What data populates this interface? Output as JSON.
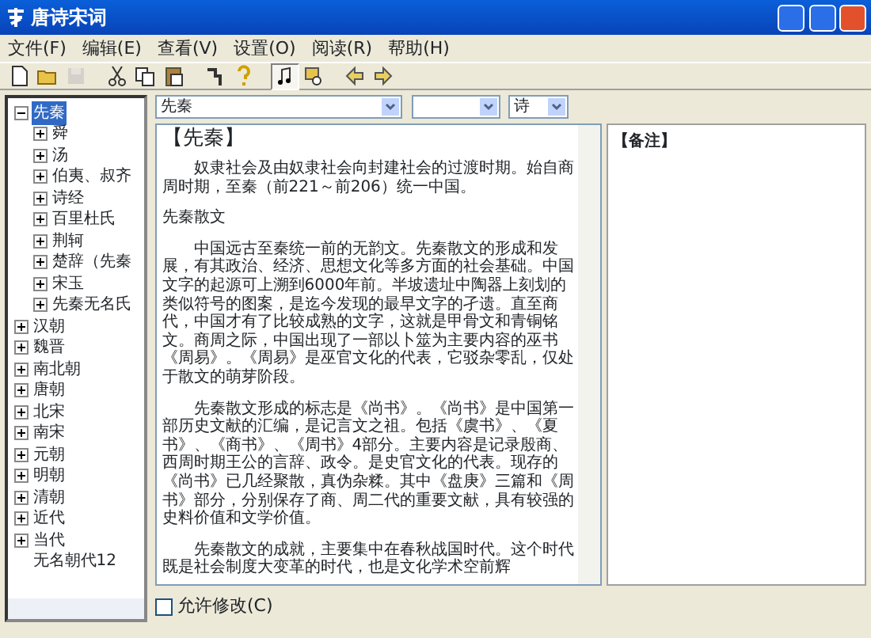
{
  "window": {
    "title": "唐诗宋词"
  },
  "menu": [
    {
      "label": "文件(F)"
    },
    {
      "label": "编辑(E)"
    },
    {
      "label": "查看(V)"
    },
    {
      "label": "设置(O)"
    },
    {
      "label": "阅读(R)"
    },
    {
      "label": "帮助(H)"
    }
  ],
  "toolbar": [
    {
      "kind": "new",
      "disabled": false,
      "pressed": false
    },
    {
      "kind": "open",
      "disabled": false,
      "pressed": false
    },
    {
      "kind": "save",
      "disabled": true,
      "pressed": false
    },
    {
      "kind": "sep"
    },
    {
      "kind": "cut",
      "disabled": false,
      "pressed": false
    },
    {
      "kind": "copy",
      "disabled": false,
      "pressed": false
    },
    {
      "kind": "paste",
      "disabled": false,
      "pressed": false
    },
    {
      "kind": "sep"
    },
    {
      "kind": "steps",
      "disabled": false,
      "pressed": false
    },
    {
      "kind": "help",
      "disabled": false,
      "pressed": false
    },
    {
      "kind": "sep"
    },
    {
      "kind": "note",
      "disabled": false,
      "pressed": true
    },
    {
      "kind": "find",
      "disabled": false,
      "pressed": false
    },
    {
      "kind": "sep"
    },
    {
      "kind": "back",
      "disabled": false,
      "pressed": false
    },
    {
      "kind": "forward",
      "disabled": false,
      "pressed": false
    }
  ],
  "tree": [
    {
      "label": "先秦",
      "expanded": true,
      "selected": true,
      "children": [
        {
          "label": "舜",
          "expanded": false,
          "selected": false
        },
        {
          "label": "汤",
          "expanded": false,
          "selected": false
        },
        {
          "label": "伯夷、叔齐",
          "expanded": false,
          "selected": false
        },
        {
          "label": "诗经",
          "expanded": false,
          "selected": false
        },
        {
          "label": "百里杜氏",
          "expanded": false,
          "selected": false
        },
        {
          "label": "荆轲",
          "expanded": false,
          "selected": false
        },
        {
          "label": "楚辞（先秦",
          "expanded": false,
          "selected": false
        },
        {
          "label": "宋玉",
          "expanded": false,
          "selected": false
        },
        {
          "label": "先秦无名氏",
          "expanded": false,
          "selected": false
        }
      ]
    },
    {
      "label": "汉朝",
      "expanded": false,
      "selected": false
    },
    {
      "label": "魏晋",
      "expanded": false,
      "selected": false
    },
    {
      "label": "南北朝",
      "expanded": false,
      "selected": false
    },
    {
      "label": "唐朝",
      "expanded": false,
      "selected": false
    },
    {
      "label": "北宋",
      "expanded": false,
      "selected": false
    },
    {
      "label": "南宋",
      "expanded": false,
      "selected": false
    },
    {
      "label": "元朝",
      "expanded": false,
      "selected": false
    },
    {
      "label": "明朝",
      "expanded": false,
      "selected": false
    },
    {
      "label": "清朝",
      "expanded": false,
      "selected": false
    },
    {
      "label": "近代",
      "expanded": false,
      "selected": false
    },
    {
      "label": "当代",
      "expanded": false,
      "selected": false
    },
    {
      "label": "无名朝代12",
      "leaf": true,
      "selected": false
    }
  ],
  "period_selector": {
    "value": "先秦"
  },
  "genre_selector": {
    "value": "诗"
  },
  "content": [
    {
      "kind": "heading",
      "text": "【先秦】"
    },
    {
      "kind": "para",
      "text": "奴隶社会及由奴隶社会向封建社会的过渡时期。始自商周时期，至秦（前221～前206）统一中国。"
    },
    {
      "kind": "plain",
      "text": "先秦散文"
    },
    {
      "kind": "para",
      "text": "中国远古至秦统一前的无韵文。先秦散文的形成和发展，有其政治、经济、思想文化等多方面的社会基础。中国文字的起源可上溯到6000年前。半坡遗址中陶器上刻划的类似符号的图案，是迄今发现的最早文字的孑遗。直至商代，中国才有了比较成熟的文字，这就是甲骨文和青铜铭文。商周之际，中国出现了一部以卜筮为主要内容的巫书《周易》。《周易》是巫官文化的代表，它驳杂零乱，仅处于散文的萌芽阶段。"
    },
    {
      "kind": "para",
      "text": "先秦散文形成的标志是《尚书》。《尚书》是中国第一部历史文献的汇编，是记言文之祖。包括《虞书》、《夏书》、《商书》、《周书》4部分。主要内容是记录殷商、西周时期王公的言辞、政令。是史官文化的代表。现存的《尚书》已几经聚散，真伪杂糅。其中《盘庚》三篇和《周书》部分，分别保存了商、周二代的重要文献，具有较强的史料价值和文学价值。"
    },
    {
      "kind": "para",
      "text": "先秦散文的成就，主要集中在春秋战国时代。这个时代既是社会制度大变革的时代，也是文化学术空前辉"
    }
  ],
  "notes": {
    "title": "【备注】"
  },
  "allow_edit": {
    "label": "允许修改(C)",
    "checked": false
  }
}
